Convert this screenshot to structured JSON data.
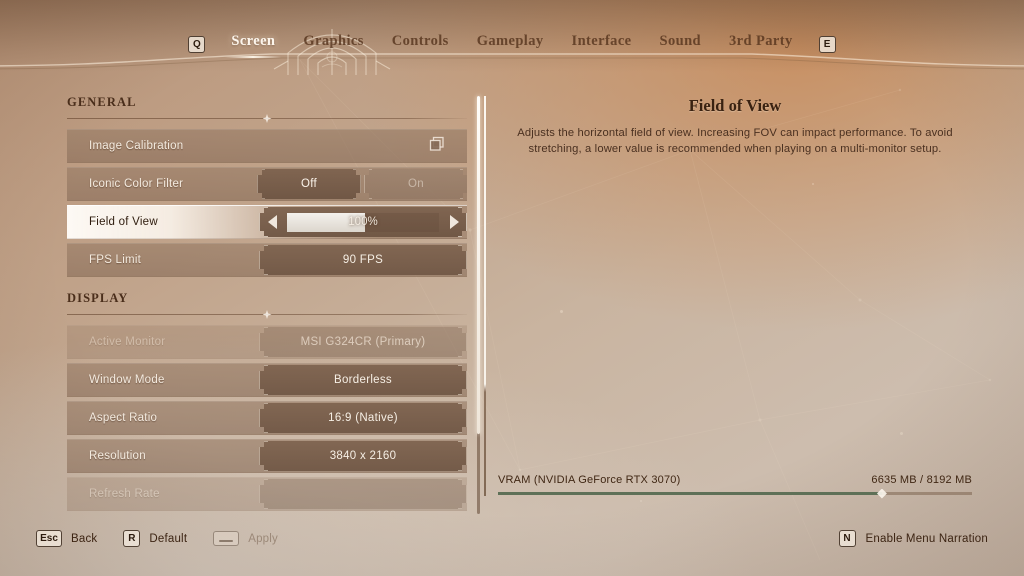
{
  "nav": {
    "prev_key": "Q",
    "next_key": "E",
    "tabs": [
      {
        "label": "Screen",
        "active": true
      },
      {
        "label": "Graphics",
        "active": false
      },
      {
        "label": "Controls",
        "active": false
      },
      {
        "label": "Gameplay",
        "active": false
      },
      {
        "label": "Interface",
        "active": false
      },
      {
        "label": "Sound",
        "active": false
      },
      {
        "label": "3rd Party",
        "active": false
      }
    ]
  },
  "settings": {
    "sections": [
      {
        "title": "GENERAL",
        "rows": [
          {
            "label": "Image Calibration",
            "type": "submenu",
            "icon": "window-copy-icon",
            "value": ""
          },
          {
            "label": "Iconic Color Filter",
            "type": "toggle",
            "options": [
              "Off",
              "On"
            ],
            "selected": "Off"
          },
          {
            "label": "Field of View",
            "type": "slider",
            "value": "100%",
            "fill_percent": 51,
            "selected": true,
            "left_arrow": "decrease-arrow",
            "right_arrow": "increase-arrow"
          },
          {
            "label": "FPS Limit",
            "type": "value",
            "value": "90 FPS"
          }
        ]
      },
      {
        "title": "DISPLAY",
        "rows": [
          {
            "label": "Active Monitor",
            "type": "value",
            "value": "MSI G324CR (Primary)",
            "disabled": true
          },
          {
            "label": "Window Mode",
            "type": "value",
            "value": "Borderless"
          },
          {
            "label": "Aspect Ratio",
            "type": "value",
            "value": "16:9 (Native)"
          },
          {
            "label": "Resolution",
            "type": "value",
            "value": "3840 x 2160"
          },
          {
            "label": "Refresh Rate",
            "type": "value",
            "value": "",
            "disabled": true
          }
        ]
      }
    ]
  },
  "detail": {
    "title": "Field of View",
    "description": "Adjusts the horizontal field of view. Increasing FOV can impact performance. To avoid stretching, a lower value is recommended when playing on a multi-monitor setup."
  },
  "vram": {
    "label": "VRAM (NVIDIA GeForce RTX 3070)",
    "value": "6635 MB / 8192 MB",
    "used_mb": 6635,
    "total_mb": 8192,
    "percent": 81
  },
  "footer": {
    "left": [
      {
        "key": "Esc",
        "label": "Back",
        "disabled": false
      },
      {
        "key": "R",
        "label": "Default",
        "disabled": false
      },
      {
        "key": "Space",
        "label": "Apply",
        "disabled": true
      }
    ],
    "right": {
      "key": "N",
      "label": "Enable Menu Narration"
    }
  },
  "colors": {
    "accent_text": "#fdf6ed",
    "label_text": "#f4ebe0",
    "heading": "#4a2e1b",
    "vram_bar": "#5e7057",
    "panel_row": "#8d705a"
  }
}
